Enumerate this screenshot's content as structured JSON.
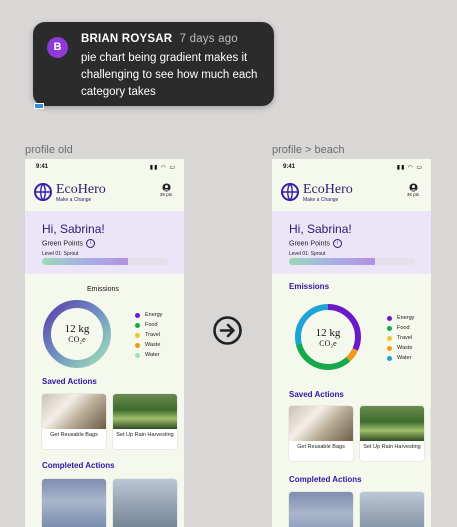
{
  "comment": {
    "avatar_letter": "B",
    "author": "BRIAN ROYSAR",
    "time": "7 days ago",
    "body": "pie chart being gradient makes it challenging to see how much each category takes"
  },
  "frames": {
    "left_label": "profile old",
    "right_label": "profile > beach"
  },
  "phone": {
    "status_time": "9:41",
    "brand": "EcoHero",
    "tagline": "Make a Change",
    "points_badge": "35 pts",
    "greeting": "Hi, Sabrina!",
    "green_points": "Green Points",
    "info": "i",
    "level": "Level 01: Sprout",
    "level_progress": 0.68,
    "emissions_title": "Emissions",
    "total_value": "12 kg",
    "total_unit": "CO₂e",
    "legend": [
      {
        "label": "Energy",
        "color": "#6a1ac9"
      },
      {
        "label": "Food",
        "color": "#18a84c"
      },
      {
        "label": "Travel",
        "color": "#ecc72a"
      },
      {
        "label": "Waste",
        "color": "#f19a16"
      },
      {
        "label": "Water",
        "color": "#1ea3d6"
      }
    ],
    "saved_actions_title": "Saved Actions",
    "saved_actions": [
      {
        "label": "Get Reusable Bags"
      },
      {
        "label": "Set Up Rain Harvesting"
      }
    ],
    "completed_actions_title": "Completed Actions"
  },
  "colors": {
    "accent": "#3216a6",
    "hero_bg": "#ece5f8",
    "phone_bg": "#f5f8ec"
  }
}
